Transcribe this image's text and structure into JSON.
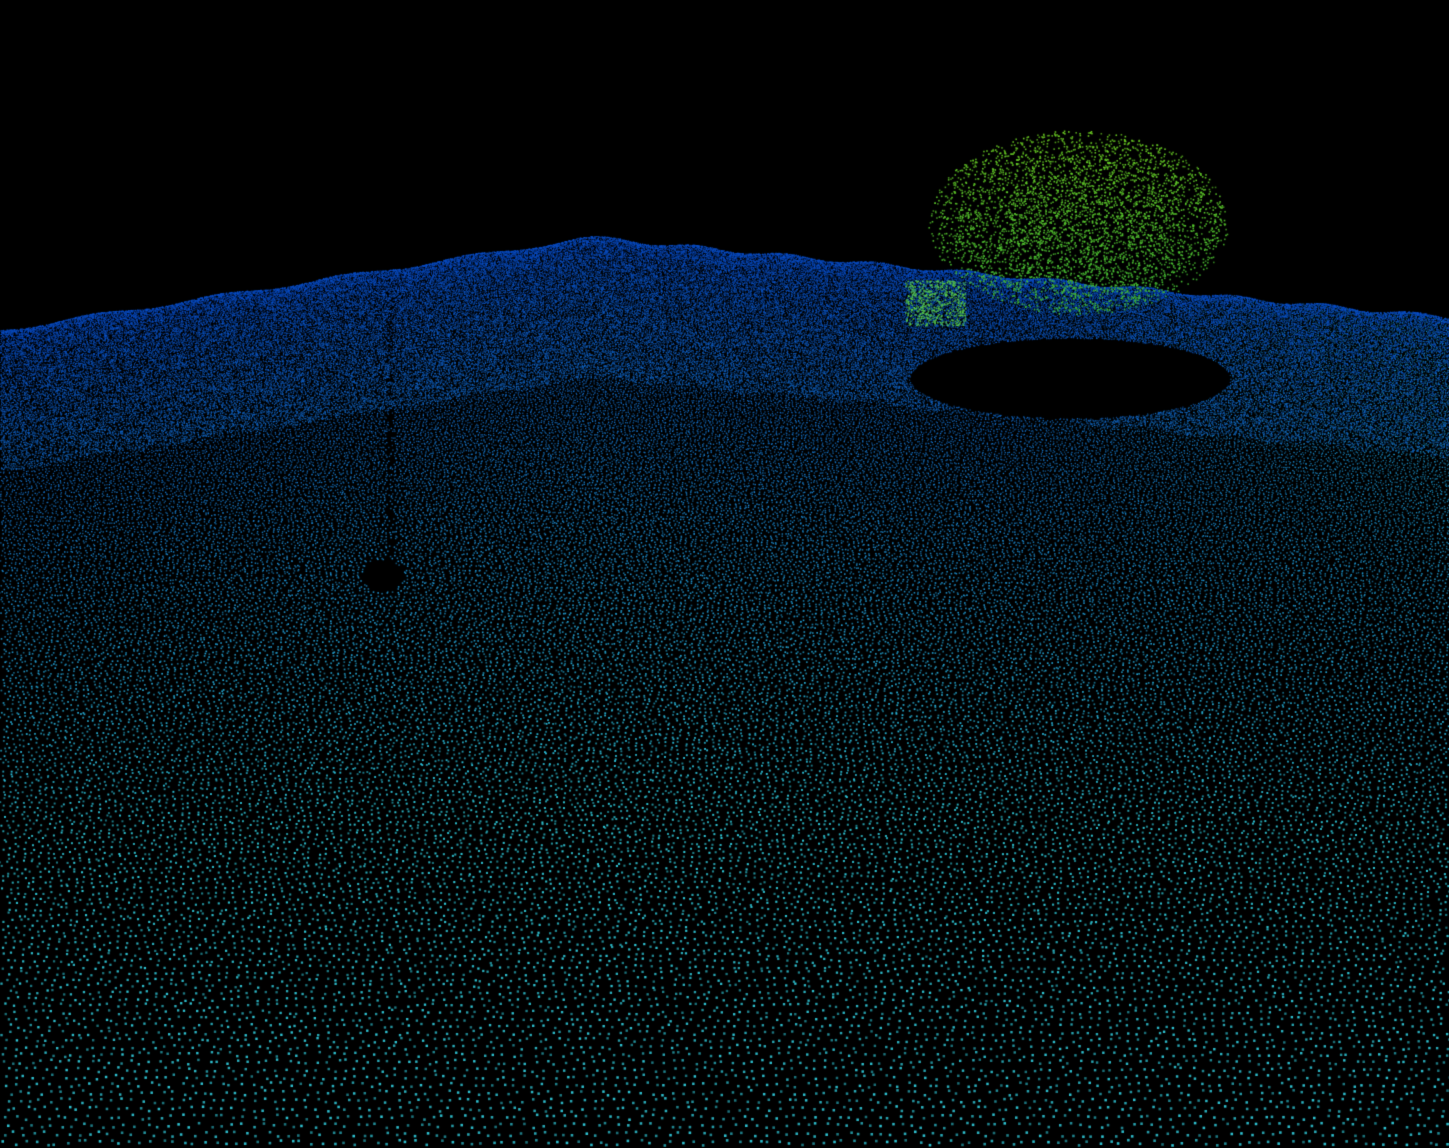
{
  "scene": {
    "background_color": "#000000",
    "colormap": {
      "low": "#30c8d8",
      "mid": "#0a4ec8",
      "high": "#7ed81e"
    },
    "objects": [
      "terrain-point-cloud",
      "tree-point-cloud",
      "occlusion-shadow"
    ]
  }
}
